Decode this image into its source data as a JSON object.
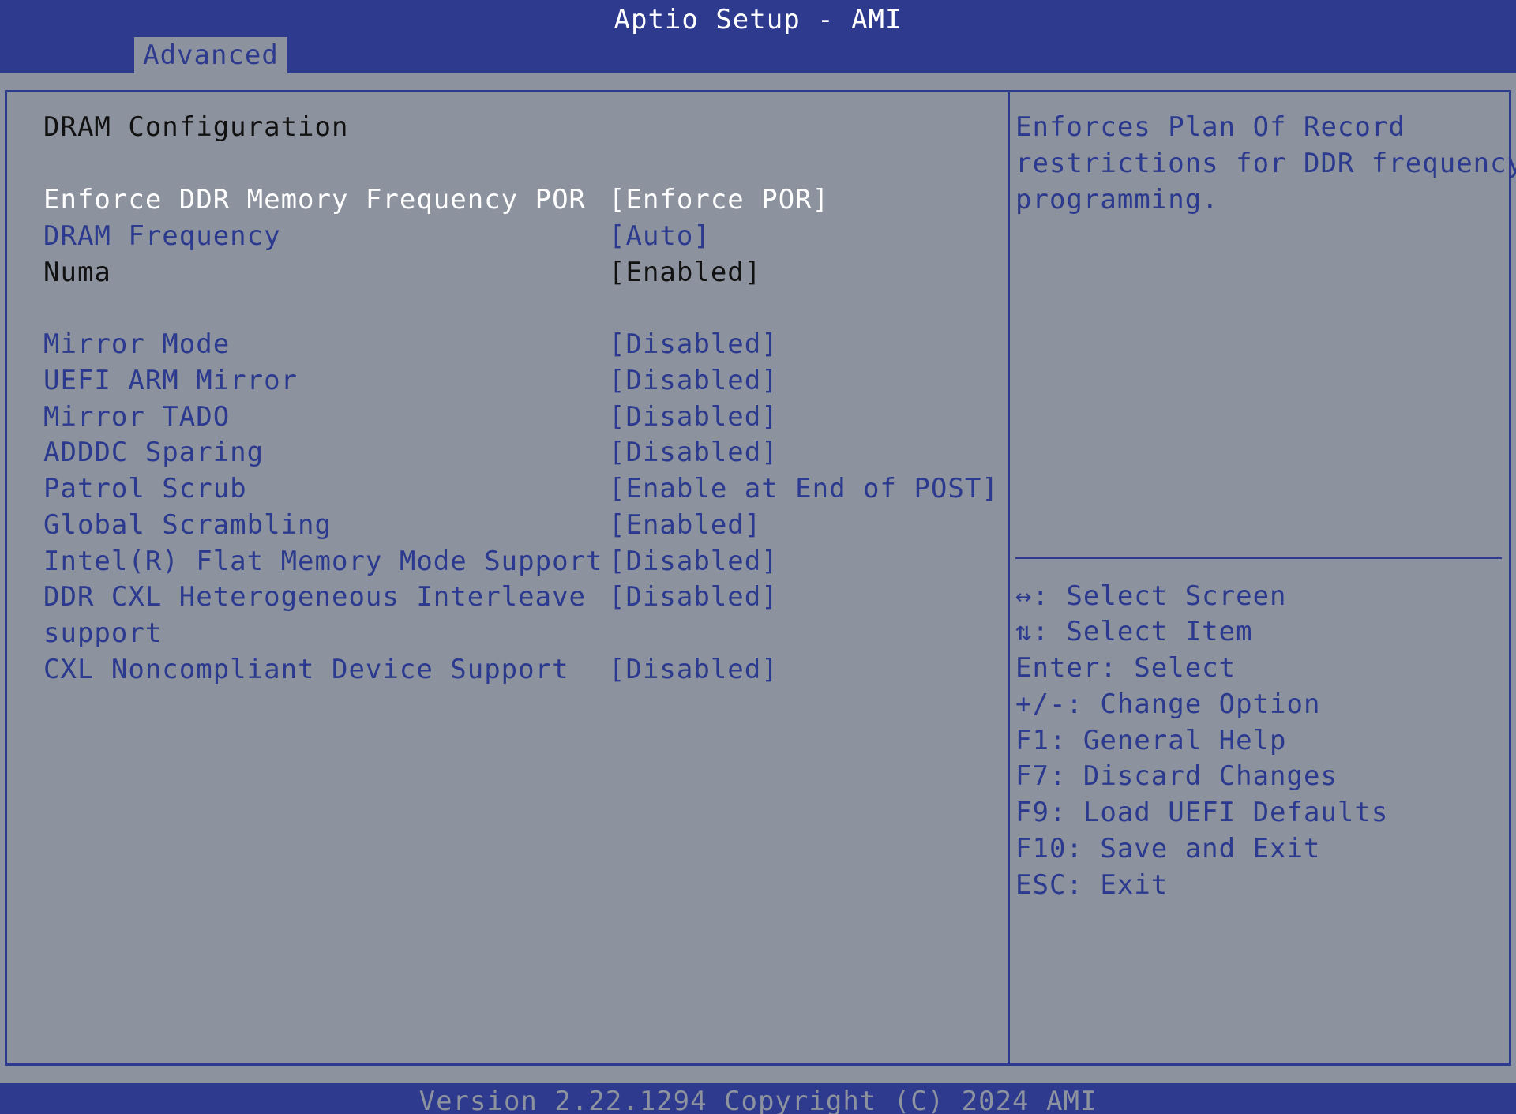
{
  "header": {
    "title": "Aptio Setup - AMI",
    "active_tab": "Advanced"
  },
  "main": {
    "section_title": "DRAM Configuration",
    "items": [
      {
        "label": "Enforce DDR Memory Frequency POR",
        "value": "[Enforce POR]"
      },
      {
        "label": "DRAM Frequency",
        "value": "[Auto]"
      },
      {
        "label": "Numa",
        "value": "[Enabled]"
      },
      {
        "label": "Mirror Mode",
        "value": "[Disabled]"
      },
      {
        "label": "UEFI ARM Mirror",
        "value": "[Disabled]"
      },
      {
        "label": "Mirror TADO",
        "value": "[Disabled]"
      },
      {
        "label": "ADDDC Sparing",
        "value": "[Disabled]"
      },
      {
        "label": "Patrol Scrub",
        "value": "[Enable at End of POST]"
      },
      {
        "label": "Global Scrambling",
        "value": "[Enabled]"
      },
      {
        "label": "Intel(R) Flat Memory Mode Support",
        "value": "[Disabled]"
      },
      {
        "label_line1": "DDR CXL Heterogeneous Interleave",
        "label_line2": "support",
        "value": "[Disabled]"
      },
      {
        "label": "CXL Noncompliant Device Support",
        "value": "[Disabled]"
      }
    ]
  },
  "help": {
    "description_lines": [
      "Enforces Plan Of Record",
      "restrictions for DDR frequency",
      "programming."
    ],
    "keys": [
      "↔: Select Screen",
      "⇅: Select Item",
      "Enter: Select",
      "+/-: Change Option",
      "F1: General Help",
      "F7: Discard Changes",
      "F9: Load UEFI Defaults",
      "F10: Save and Exit",
      "ESC: Exit"
    ]
  },
  "footer": {
    "text": "Version 2.22.1294 Copyright (C) 2024 AMI"
  },
  "colors": {
    "frame_blue": "#2e3a8e",
    "background_gray": "#8c929e",
    "selected_text": "#ffffff",
    "option_text": "#2b3a8f",
    "readonly_text": "#111111"
  }
}
